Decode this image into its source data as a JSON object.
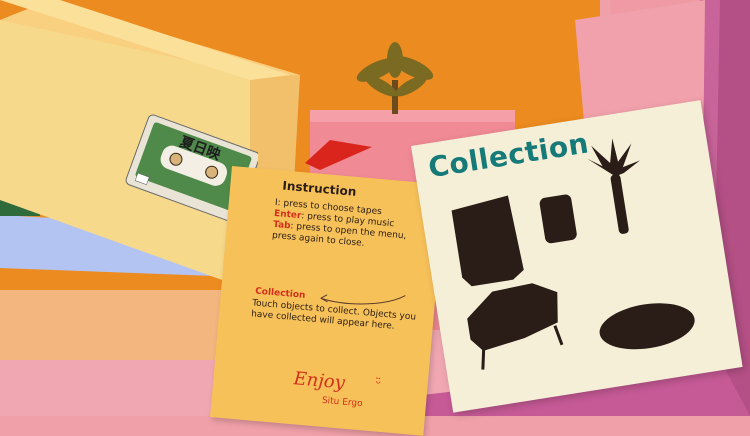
{
  "instruction": {
    "title": "Instruction",
    "lines": [
      {
        "key": "",
        "text": "I: press to choose tapes"
      },
      {
        "key": "Enter",
        "text": ": press to play music"
      },
      {
        "key": "Tab",
        "text": ": press to open the menu, press again to close."
      }
    ],
    "collection_heading": "Collection",
    "collection_text": "Touch objects to collect. Objects you have collected will appear here.",
    "signature": "Enjoy",
    "signature_sub": "Situ Ergo",
    "cassette_label": "夏日映"
  },
  "collection_panel": {
    "title": "Collection",
    "items": [
      "cabinet",
      "stool",
      "palm-plant",
      "armchair",
      "rug"
    ]
  },
  "colors": {
    "wall_orange": "#ec8b1f",
    "wall_pink": "#ef9aa5",
    "wall_magenta": "#c9649a",
    "card_yellow": "#f7c15a",
    "card_cream": "#f6efd8",
    "title_teal": "#157a78",
    "silhouette": "#2a1c16",
    "accent_red": "#d2301c"
  }
}
